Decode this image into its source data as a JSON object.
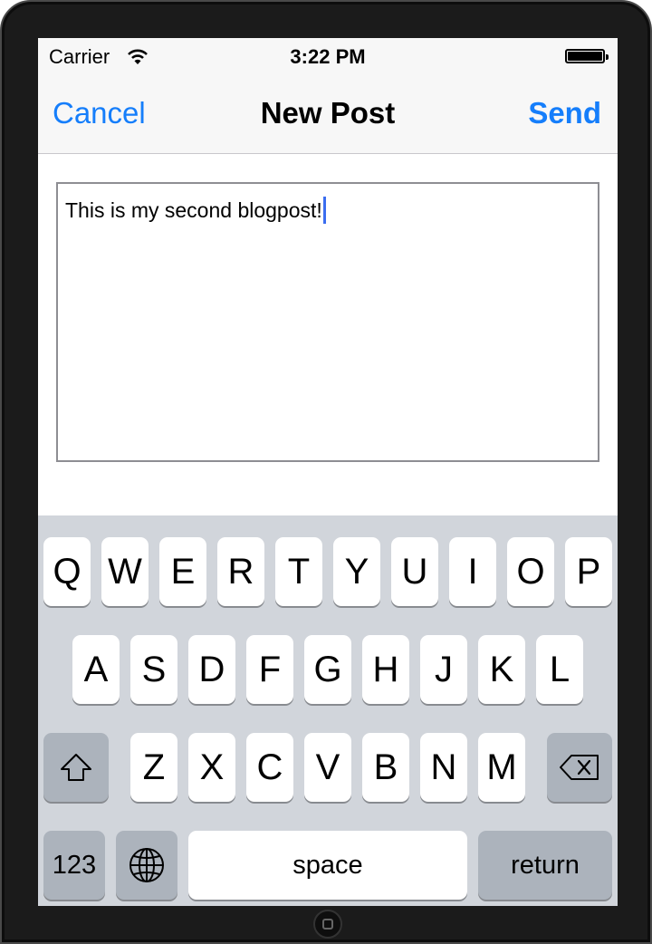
{
  "status_bar": {
    "carrier": "Carrier",
    "time": "3:22 PM"
  },
  "nav": {
    "cancel": "Cancel",
    "title": "New Post",
    "send": "Send"
  },
  "editor": {
    "text": "This is my second blogpost!"
  },
  "keyboard": {
    "row1": [
      "Q",
      "W",
      "E",
      "R",
      "T",
      "Y",
      "U",
      "I",
      "O",
      "P"
    ],
    "row2": [
      "A",
      "S",
      "D",
      "F",
      "G",
      "H",
      "J",
      "K",
      "L"
    ],
    "row3": [
      "Z",
      "X",
      "C",
      "V",
      "B",
      "N",
      "M"
    ],
    "numbers": "123",
    "space": "space",
    "return": "return"
  },
  "colors": {
    "accent": "#157efb",
    "caret": "#3b6df0",
    "keyboard_bg": "#d1d5db",
    "function_key": "#acb3bc"
  },
  "icons": [
    "wifi-icon",
    "battery-icon",
    "shift-icon",
    "delete-icon",
    "globe-icon"
  ]
}
